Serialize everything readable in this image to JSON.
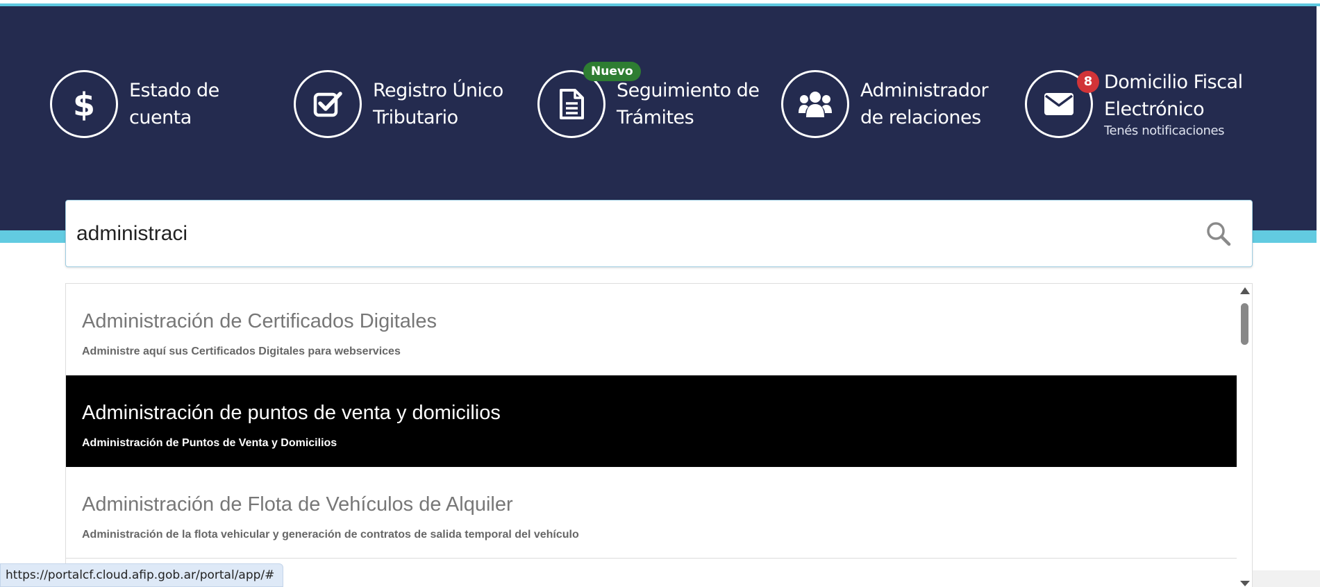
{
  "header": {
    "shortcuts": [
      {
        "line1": "Estado de",
        "line2": "cuenta",
        "icon": "dollar-icon"
      },
      {
        "line1": "Registro Único",
        "line2": "Tributario",
        "icon": "checkbox-icon"
      },
      {
        "line1": "Seguimiento de",
        "line2": "Trámites",
        "icon": "document-icon",
        "badge": "Nuevo"
      },
      {
        "line1": "Administrador",
        "line2": "de relaciones",
        "icon": "users-icon"
      },
      {
        "line1": "Domicilio Fiscal",
        "line2": "Electrónico",
        "subtitle": "Tenés notificaciones",
        "icon": "envelope-icon",
        "badge_count": "8"
      }
    ]
  },
  "search": {
    "value": "administraci",
    "icon": "search-icon"
  },
  "results": [
    {
      "title": "Administración de Certificados Digitales",
      "description": "Administre aquí sus Certificados Digitales para webservices"
    },
    {
      "title": "Administración de puntos de venta y domicilios",
      "description": "Administración de Puntos de Venta y Domicilios",
      "highlighted": true
    },
    {
      "title": "Administración de Flota de Vehículos de Alquiler",
      "description": "Administración de la flota vehicular y generación de contratos de salida temporal del vehículo"
    }
  ],
  "status_bar": {
    "url": "https://portalcf.cloud.afip.gob.ar/portal/app/#"
  },
  "colors": {
    "header_bg": "#242b4f",
    "accent_cyan": "#62cbe1",
    "badge_green": "#2e7d32",
    "badge_red": "#d13438",
    "highlight_bg": "#000000"
  }
}
